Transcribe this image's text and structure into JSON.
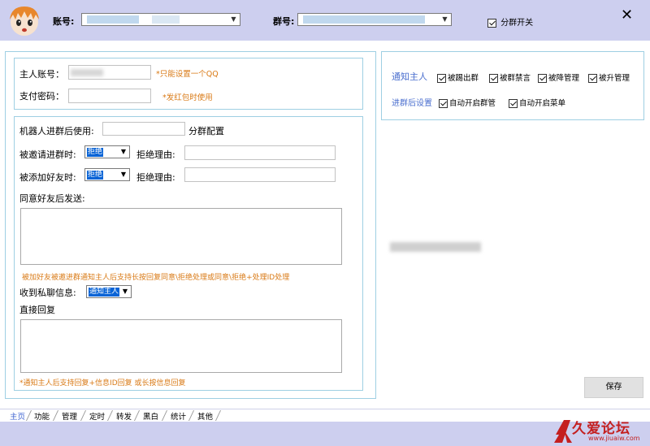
{
  "header": {
    "account_label": "账号:",
    "group_label": "群号:",
    "group_switch_label": "分群开关",
    "close_symbol": "✕"
  },
  "account_panel": {
    "owner_label": "主人账号：",
    "owner_hint": "*只能设置一个QQ",
    "pay_label": "支付密码：",
    "pay_hint": "*发红包时使用"
  },
  "robot_panel": {
    "after_join_label": "机器人进群后使用:",
    "group_config_label": "分群配置",
    "invite_label": "被邀请进群时:",
    "invite_value": "拒绝",
    "invite_reason_label": "拒绝理由:",
    "add_friend_label": "被添加好友时:",
    "add_friend_value": "拒绝",
    "add_friend_reason_label": "拒绝理由:",
    "after_agree_label": "同意好友后发送:",
    "invite_hint": "被加好友被邀进群通知主人后支持长按回复同意\\拒绝处理或同意\\拒绝+处理ID处理",
    "private_msg_label": "收到私聊信息:",
    "private_msg_value": "通知主人",
    "direct_reply_label": "直接回复",
    "reply_hint": "*通知主人后支持回复+信息ID回复 或长按信息回复"
  },
  "notify_panel": {
    "notify_owner_label": "通知主人",
    "items": [
      "被踢出群",
      "被群禁言",
      "被降管理",
      "被升管理"
    ],
    "after_join_label": "进群后设置",
    "after_join_items": [
      "自动开启群管",
      "自动开启菜单"
    ]
  },
  "save_label": "保存",
  "tabs": [
    "主页",
    "功能",
    "管理",
    "定时",
    "转发",
    "黑白",
    "统计",
    "其他"
  ],
  "watermark": {
    "text": "久爱论坛",
    "url": "www.jiuaiw.com"
  },
  "colors": {
    "titlebar_bg": "#cdcfef",
    "panel_border": "#9ecfe3",
    "hint_orange": "#d97a16",
    "label_blue": "#4b6fcf",
    "watermark_red": "#c41f1f"
  }
}
